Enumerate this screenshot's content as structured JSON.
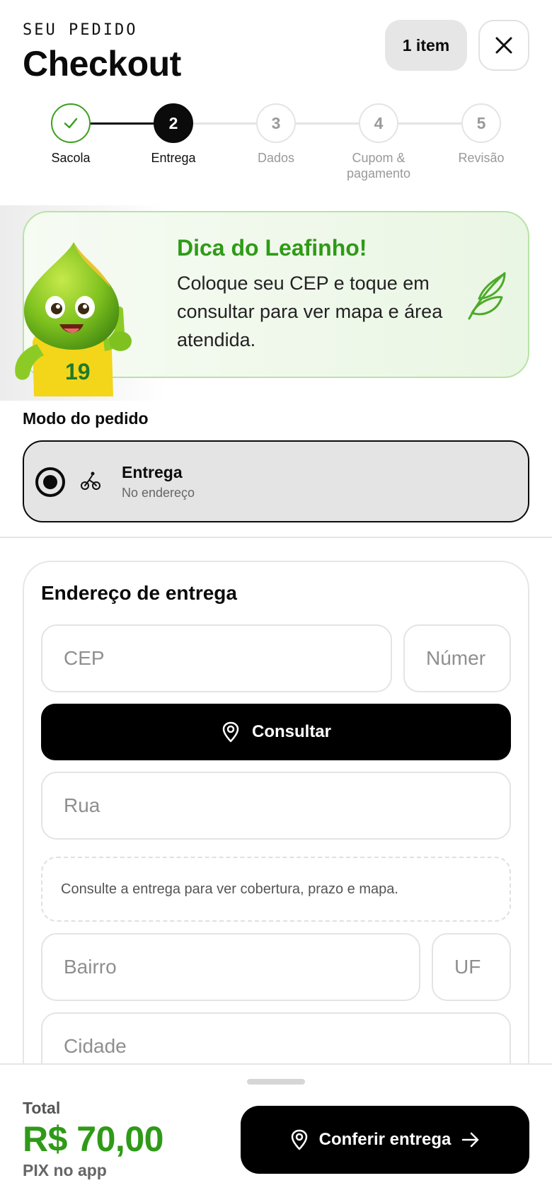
{
  "header": {
    "eyebrow": "SEU PEDIDO",
    "title": "Checkout",
    "items_badge": "1 item",
    "close_icon": "close-icon"
  },
  "stepper": {
    "current_step": 2,
    "steps": [
      {
        "number": "1",
        "label": "Sacola",
        "status": "done",
        "icon": "check-icon"
      },
      {
        "number": "2",
        "label": "Entrega",
        "status": "active"
      },
      {
        "number": "3",
        "label": "Dados",
        "status": "pending"
      },
      {
        "number": "4",
        "label": "Cupom & pagamento",
        "status": "pending"
      },
      {
        "number": "5",
        "label": "Revisão",
        "status": "pending"
      }
    ]
  },
  "tip": {
    "title": "Dica do Leafinho!",
    "text": "Coloque seu CEP e toque em consultar para ver mapa e área atendida.",
    "mascot_jersey_number": "19",
    "icon": "leaf-icon"
  },
  "order_mode": {
    "label": "Modo do pedido",
    "option": {
      "title": "Entrega",
      "subtitle": "No endereço",
      "selected": true,
      "icon": "bike-icon"
    }
  },
  "address": {
    "title": "Endereço de entrega",
    "cep_placeholder": "CEP",
    "number_placeholder": "Númer",
    "consult_label": "Consultar",
    "consult_icon": "map-pin-icon",
    "street_placeholder": "Rua",
    "coverage_hint": "Consulte a entrega para ver cobertura, prazo e mapa.",
    "neighborhood_placeholder": "Bairro",
    "state_placeholder": "UF",
    "city_placeholder": "Cidade"
  },
  "footer": {
    "total_label": "Total",
    "total_value": "R$ 70,00",
    "payment_method": "PIX no app",
    "cta_label": "Conferir entrega",
    "cta_icon": "map-pin-icon",
    "cta_arrow": "arrow-right-icon"
  },
  "colors": {
    "accent_green": "#2f9a17",
    "tip_border": "#b7e3a6",
    "primary": "#000000"
  }
}
